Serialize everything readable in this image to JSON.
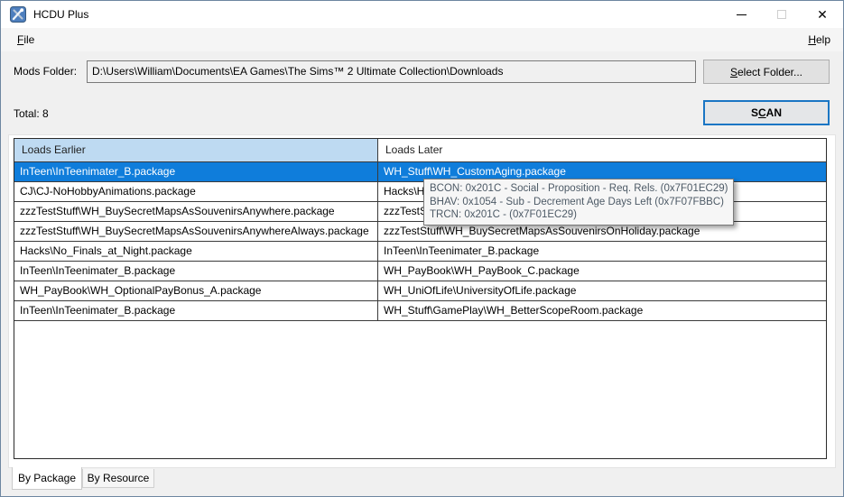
{
  "window": {
    "title": "HCDU Plus",
    "controls": {
      "close_glyph": "✕"
    }
  },
  "menu": {
    "file": {
      "pre": "",
      "key": "F",
      "rest": "ile"
    },
    "help": {
      "pre": "",
      "key": "H",
      "rest": "elp"
    }
  },
  "mods_folder": {
    "label": "Mods Folder:",
    "path": "D:\\Users\\William\\Documents\\EA Games\\The Sims™ 2 Ultimate Collection\\Downloads",
    "select_button": {
      "pre": "",
      "key": "S",
      "rest": "elect Folder..."
    }
  },
  "scan": {
    "total": "Total: 8",
    "button": {
      "pre": "S",
      "key": "C",
      "rest": "AN"
    }
  },
  "table": {
    "columns": [
      "Loads Earlier",
      "Loads Later"
    ],
    "selected_row_index": 0,
    "rows": [
      [
        "InTeen\\InTeenimater_B.package",
        "WH_Stuff\\WH_CustomAging.package"
      ],
      [
        "CJ\\CJ-NoHobbyAnimations.package",
        "Hacks\\Ho"
      ],
      [
        "zzzTestStuff\\WH_BuySecretMapsAsSouvenirsAnywhere.package",
        "zzzTestS"
      ],
      [
        "zzzTestStuff\\WH_BuySecretMapsAsSouvenirsAnywhereAlways.package",
        "zzzTestStuff\\WH_BuySecretMapsAsSouvenirsOnHoliday.package"
      ],
      [
        "Hacks\\No_Finals_at_Night.package",
        "InTeen\\InTeenimater_B.package"
      ],
      [
        "InTeen\\InTeenimater_B.package",
        "WH_PayBook\\WH_PayBook_C.package"
      ],
      [
        "WH_PayBook\\WH_OptionalPayBonus_A.package",
        "WH_UniOfLife\\UniversityOfLife.package"
      ],
      [
        "InTeen\\InTeenimater_B.package",
        "WH_Stuff\\GamePlay\\WH_BetterScopeRoom.package"
      ]
    ]
  },
  "tooltip": {
    "lines": [
      "BCON: 0x201C - Social - Proposition - Req. Rels. (0x7F01EC29)",
      "BHAV: 0x1054 - Sub - Decrement Age Days Left (0x7F07FBBC)",
      "TRCN: 0x201C -  (0x7F01EC29)"
    ]
  },
  "tabs": [
    {
      "label": "By Package",
      "active": true
    },
    {
      "label": "By Resource",
      "active": false
    }
  ],
  "colors": {
    "selection_blue": "#0f7ddb",
    "header_blue": "#bedaf2",
    "scan_border_blue": "#1a76c4",
    "window_bg": "#f0f0f0",
    "icon_blue": "#4e7fbe"
  }
}
